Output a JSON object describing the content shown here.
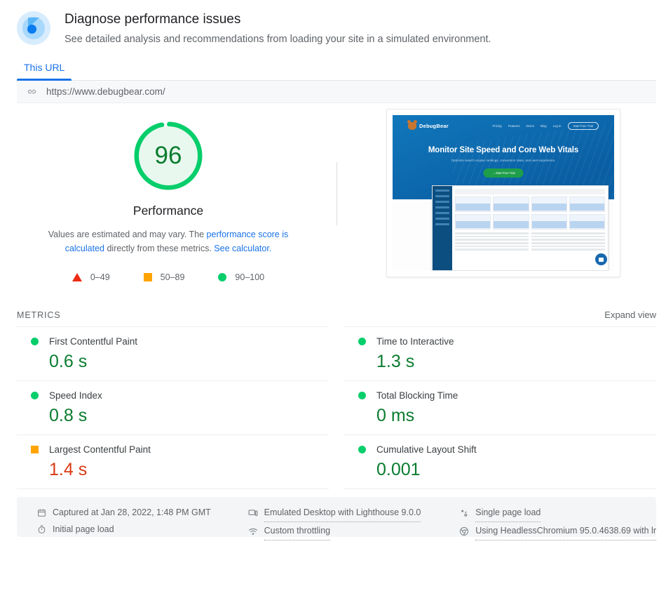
{
  "header": {
    "logo_icon": "lighthouse-logo-icon",
    "title": "Diagnose performance issues",
    "subtitle": "See detailed analysis and recommendations from loading your site in a simulated environment."
  },
  "tabs": [
    {
      "label": "This URL",
      "active": true
    }
  ],
  "urlbar": {
    "icon": "link-icon",
    "value": "https://www.debugbear.com/"
  },
  "score": {
    "value": "96",
    "category_label": "Performance",
    "disclaimer_prefix": "Values are estimated and may vary. The ",
    "disclaimer_link1": "performance score is calculated",
    "disclaimer_middle": "directly from these metrics. ",
    "disclaimer_link2": "See calculator.",
    "ring_color": "#06ce6b",
    "fill_color": "#e8f8ee",
    "number_color": "#0a7c2f",
    "percent": 96
  },
  "legend": [
    {
      "shape": "triangle",
      "color": "#ee2b12",
      "range": "0–49"
    },
    {
      "shape": "square",
      "color": "#ffa400",
      "range": "50–89"
    },
    {
      "shape": "circle",
      "color": "#06ce6b",
      "range": "90–100"
    }
  ],
  "screenshot": {
    "name": "page-screenshot-thumbnail",
    "site_brand": "DebugBear",
    "nav_links": [
      "Pricing",
      "Features",
      "Demo",
      "Blog",
      "Log In"
    ],
    "nav_cta": "Start Free Trial",
    "headline": "Monitor Site Speed and Core Web Vitals",
    "subheadline": "Optimize search engine rankings, conversion rates, and user experience.",
    "hero_button": "→ Start Free Trial"
  },
  "metrics_section": {
    "label": "METRICS",
    "expand_label": "Expand view",
    "items": [
      {
        "name": "First Contentful Paint",
        "value": "0.6 s",
        "status": "circle",
        "status_color": "#06ce6b",
        "value_color": "#0a7c2f"
      },
      {
        "name": "Time to Interactive",
        "value": "1.3 s",
        "status": "circle",
        "status_color": "#06ce6b",
        "value_color": "#0a7c2f"
      },
      {
        "name": "Speed Index",
        "value": "0.8 s",
        "status": "circle",
        "status_color": "#06ce6b",
        "value_color": "#0a7c2f"
      },
      {
        "name": "Total Blocking Time",
        "value": "0 ms",
        "status": "circle",
        "status_color": "#06ce6b",
        "value_color": "#0a7c2f"
      },
      {
        "name": "Largest Contentful Paint",
        "value": "1.4 s",
        "status": "square",
        "status_color": "#ffa400",
        "value_color": "#d93a14"
      },
      {
        "name": "Cumulative Layout Shift",
        "value": "0.001",
        "status": "circle",
        "status_color": "#06ce6b",
        "value_color": "#0a7c2f"
      }
    ]
  },
  "footer": {
    "columns": [
      [
        {
          "icon": "calendar-icon",
          "text": "Captured at Jan 28, 2022, 1:48 PM GMT",
          "dotted": false
        },
        {
          "icon": "stopwatch-icon",
          "text": "Initial page load",
          "dotted": false
        }
      ],
      [
        {
          "icon": "desktop-device-icon",
          "text": "Emulated Desktop with Lighthouse 9.0.0",
          "dotted": true
        },
        {
          "icon": "throttling-icon",
          "text": "Custom throttling",
          "dotted": true
        }
      ],
      [
        {
          "icon": "single-page-load-icon",
          "text": "Single page load",
          "dotted": true
        },
        {
          "icon": "chrome-icon",
          "text": "Using HeadlessChromium 95.0.4638.69 with lr",
          "dotted": true
        }
      ]
    ]
  }
}
